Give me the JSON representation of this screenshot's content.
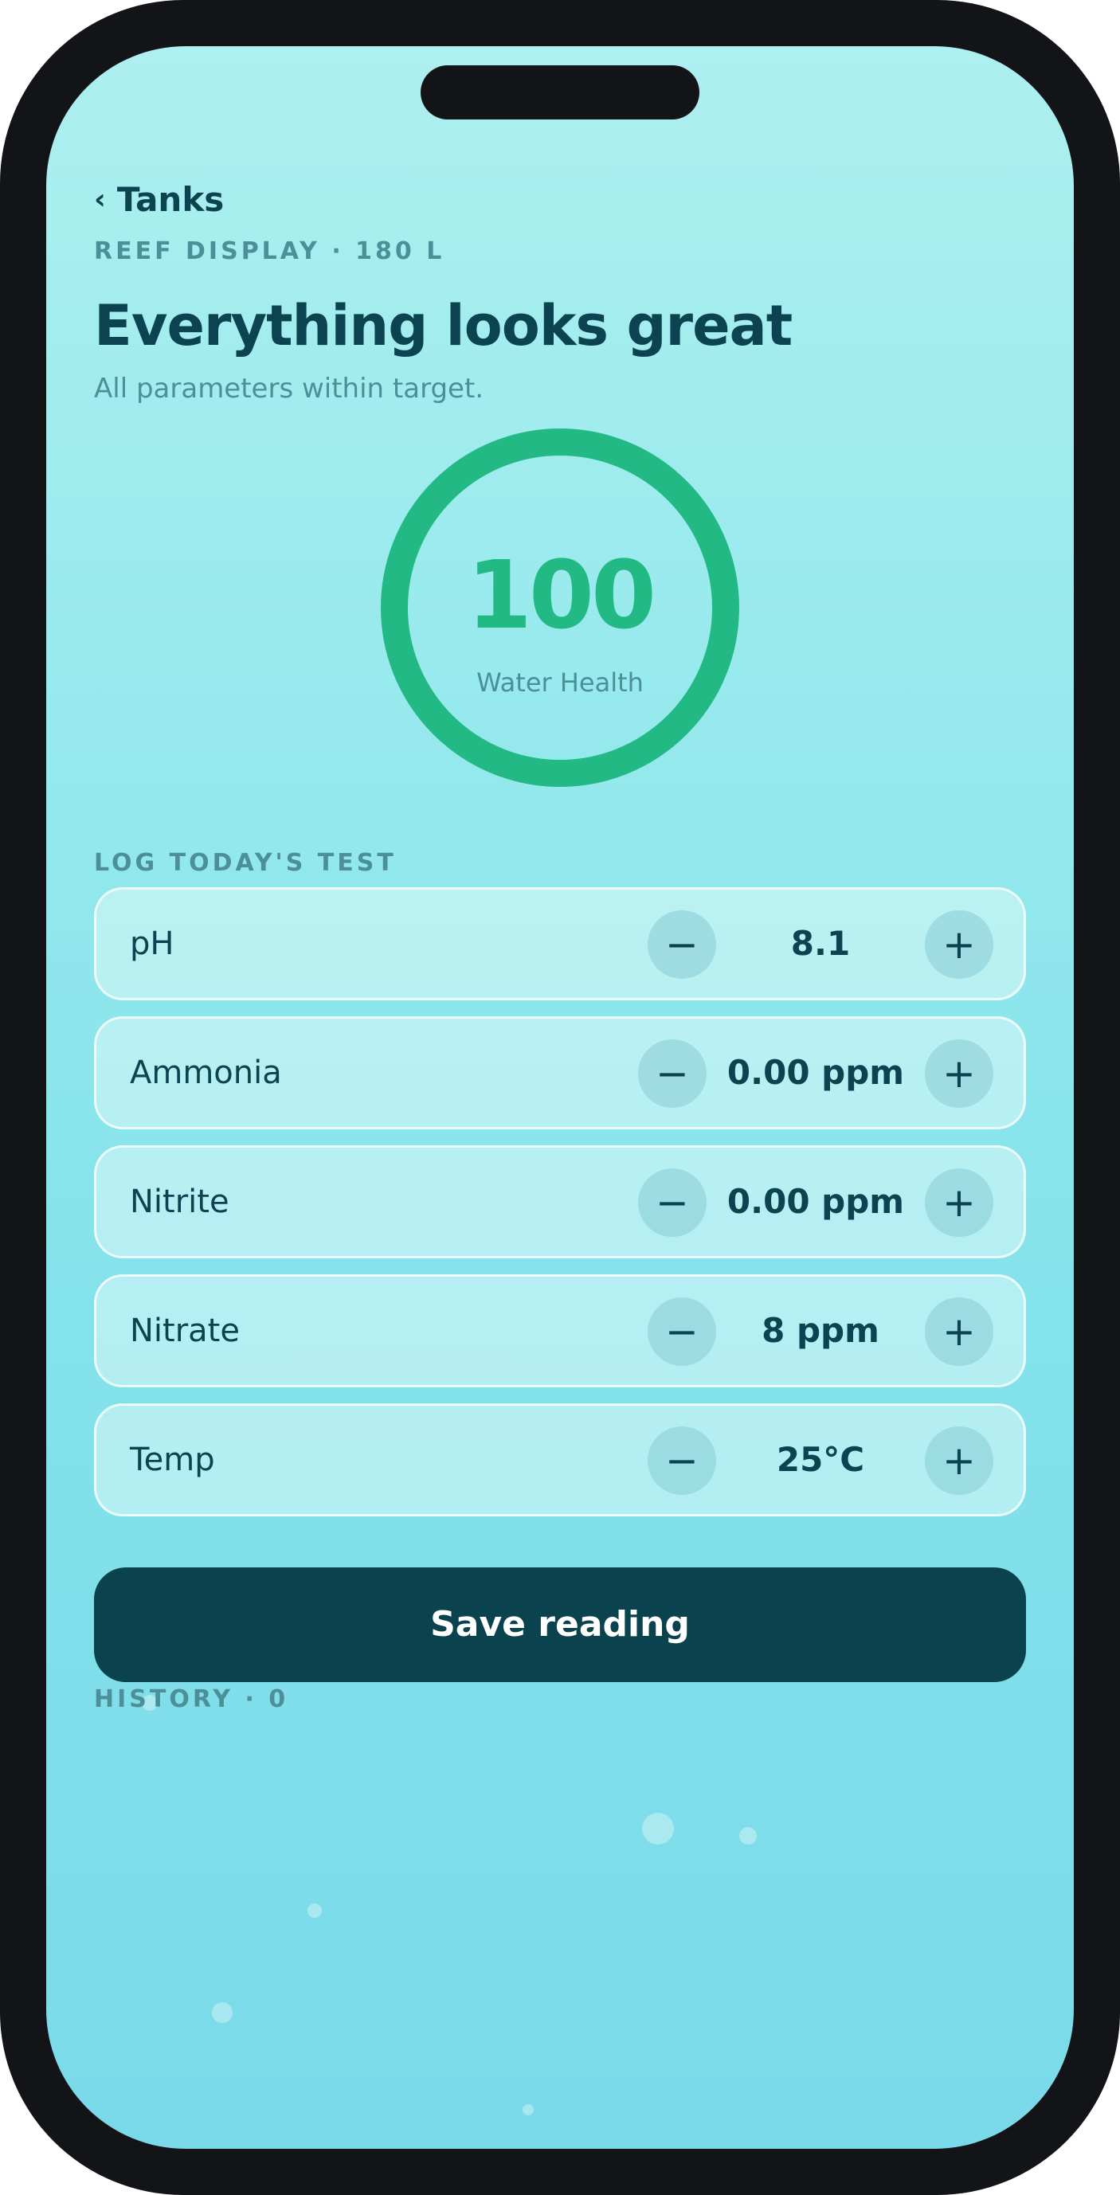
{
  "nav": {
    "back_label": "Tanks",
    "back_icon": "chevron-left"
  },
  "tank": {
    "name_line": "REEF DISPLAY · 180 L"
  },
  "status": {
    "headline": "Everything looks great",
    "subline": "All parameters within target."
  },
  "health": {
    "score": "100",
    "label": "Water Health",
    "fraction": 1.0,
    "color": "#22b985"
  },
  "log": {
    "section_label": "LOG TODAY'S TEST",
    "decrement_symbol": "−",
    "increment_symbol": "+",
    "params": [
      {
        "label": "pH",
        "value": "8.1"
      },
      {
        "label": "Ammonia",
        "value": "0.00 ppm"
      },
      {
        "label": "Nitrite",
        "value": "0.00 ppm"
      },
      {
        "label": "Nitrate",
        "value": "8 ppm"
      },
      {
        "label": "Temp",
        "value": "25°C"
      }
    ]
  },
  "save_button": {
    "label": "Save reading"
  },
  "history": {
    "label": "HISTORY · 0"
  },
  "colors": {
    "primary_dark": "#0a424d",
    "accent_green": "#22b985",
    "muted_text": "#4d8f99"
  }
}
